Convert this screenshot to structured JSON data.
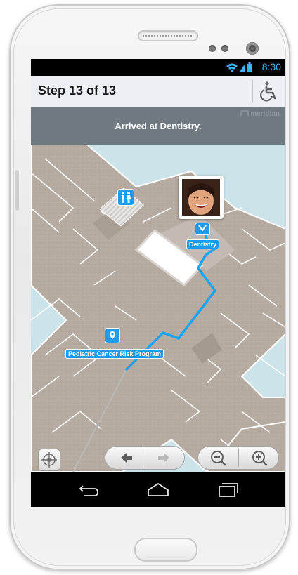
{
  "status_bar": {
    "time": "8:30"
  },
  "header": {
    "title": "Step 13 of 13"
  },
  "banner": {
    "message": "Arrived at Dentistry.",
    "brand": "meridian"
  },
  "map": {
    "destination_label": "Dentistry",
    "poi_label": "Pediatric Cancer Risk Program"
  },
  "colors": {
    "accent": "#1e9bea",
    "route": "#1aa3f0",
    "banner_bg": "#6f7980",
    "title_bg": "#ecf0f4",
    "floor": "#b7ada3",
    "water": "#cce3ea"
  },
  "icons": {
    "accessibility": "wheelchair-icon",
    "restroom": "restroom-icon",
    "poi": "location-pin-icon",
    "locate": "compass-icon",
    "previous": "arrow-left-icon",
    "next": "arrow-right-icon",
    "zoom_out": "zoom-out-icon",
    "zoom_in": "zoom-in-icon",
    "back": "back-icon",
    "home": "home-icon",
    "recent": "recent-apps-icon"
  }
}
